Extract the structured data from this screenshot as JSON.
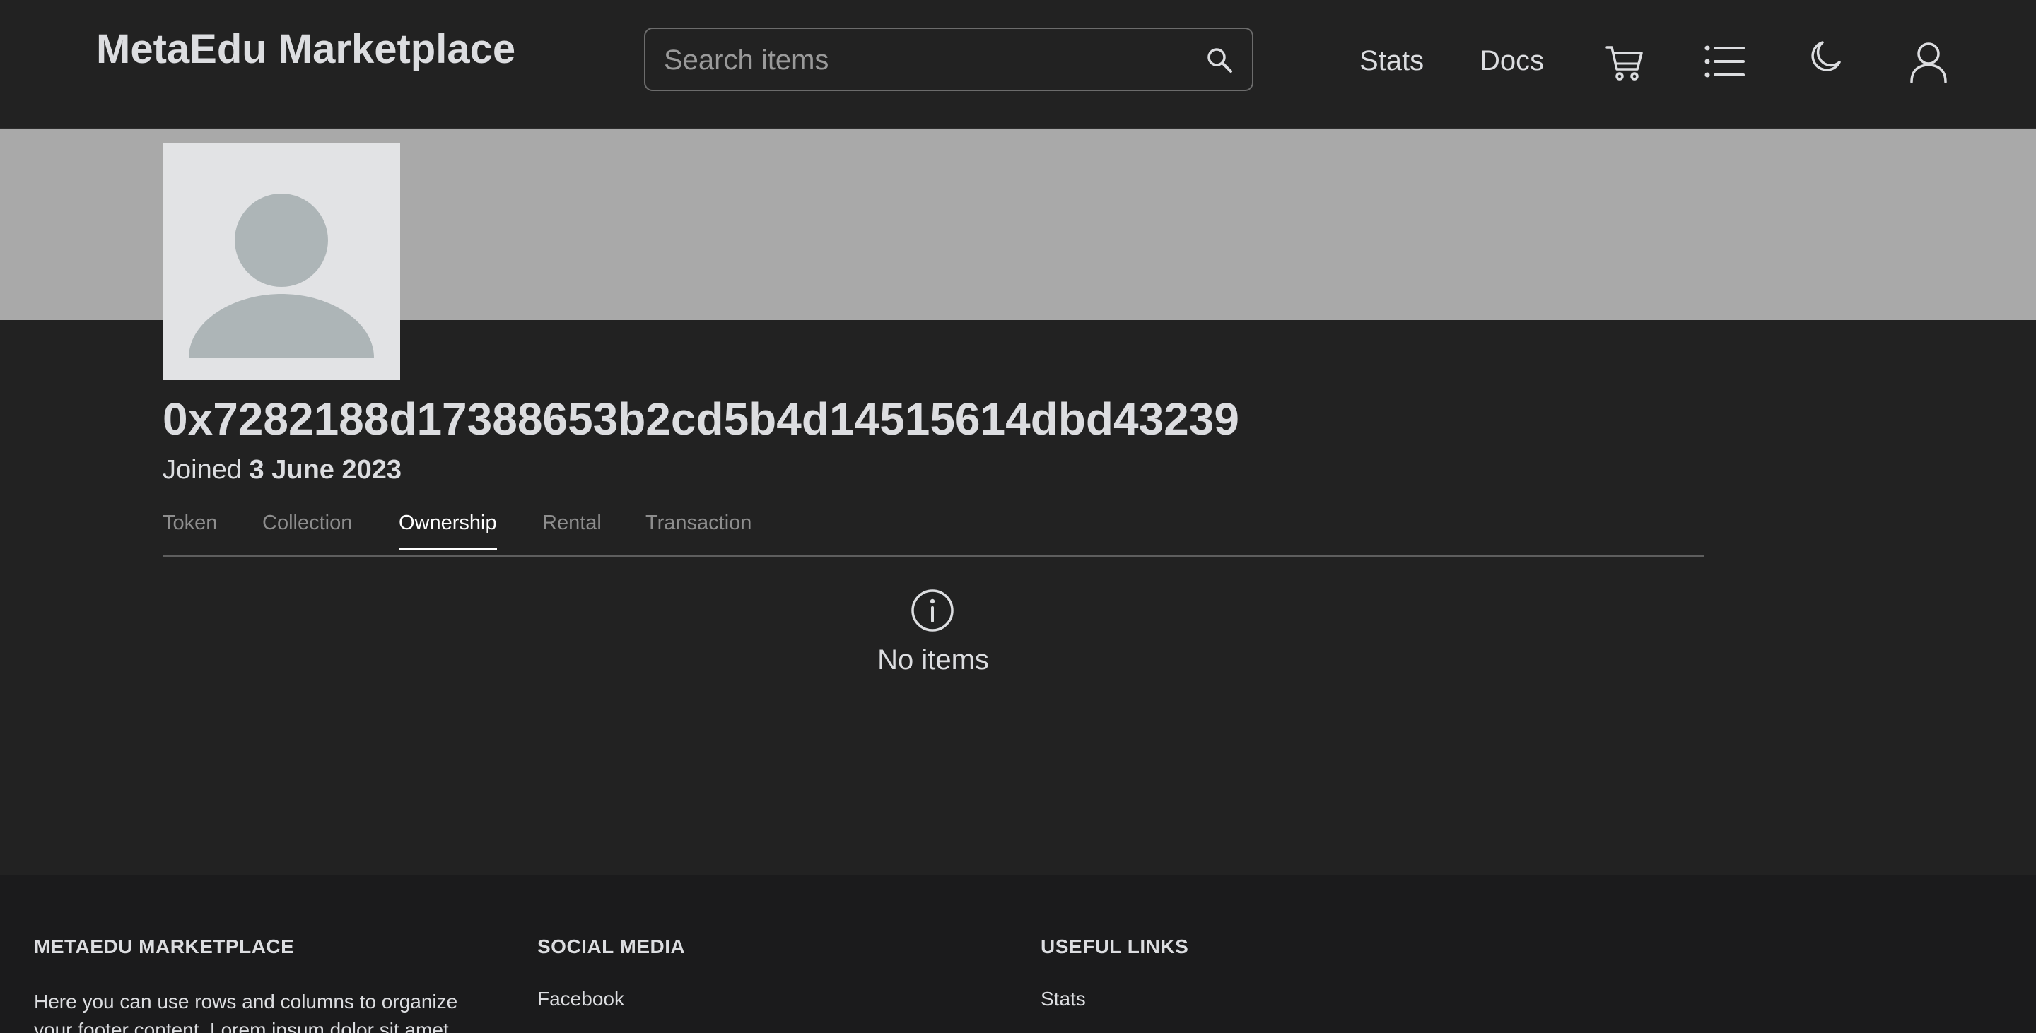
{
  "header": {
    "brand": "MetaEdu Marketplace",
    "search": {
      "placeholder": "Search items",
      "value": ""
    },
    "nav": [
      {
        "label": "Stats"
      },
      {
        "label": "Docs"
      }
    ],
    "icons": [
      "cart-icon",
      "list-icon",
      "moon-icon",
      "user-icon"
    ]
  },
  "profile": {
    "address": "0x7282188d17388653b2cd5b4d14515614dbd43239",
    "joined_label": "Joined",
    "joined_date": "3 June 2023"
  },
  "tabs": [
    {
      "label": "Token",
      "active": false
    },
    {
      "label": "Collection",
      "active": false
    },
    {
      "label": "Ownership",
      "active": true
    },
    {
      "label": "Rental",
      "active": false
    },
    {
      "label": "Transaction",
      "active": false
    }
  ],
  "empty_state": {
    "icon": "info-icon",
    "text": "No items"
  },
  "footer": {
    "about": {
      "heading": "METAEDU MARKETPLACE",
      "text": "Here you can use rows and columns to organize your footer content. Lorem ipsum dolor sit amet, consectetur adipisicing elit."
    },
    "social": {
      "heading": "SOCIAL MEDIA",
      "links": [
        "Facebook"
      ]
    },
    "useful": {
      "heading": "USEFUL LINKS",
      "links": [
        "Stats"
      ]
    }
  },
  "colors": {
    "background": "#222222",
    "banner": "#a9a9a9",
    "avatar_bg": "#e2e3e5",
    "avatar_figure": "#adb5b7",
    "footer_bg": "#1b1b1c",
    "text": "#dcdde0",
    "muted": "#8e8e8e"
  }
}
